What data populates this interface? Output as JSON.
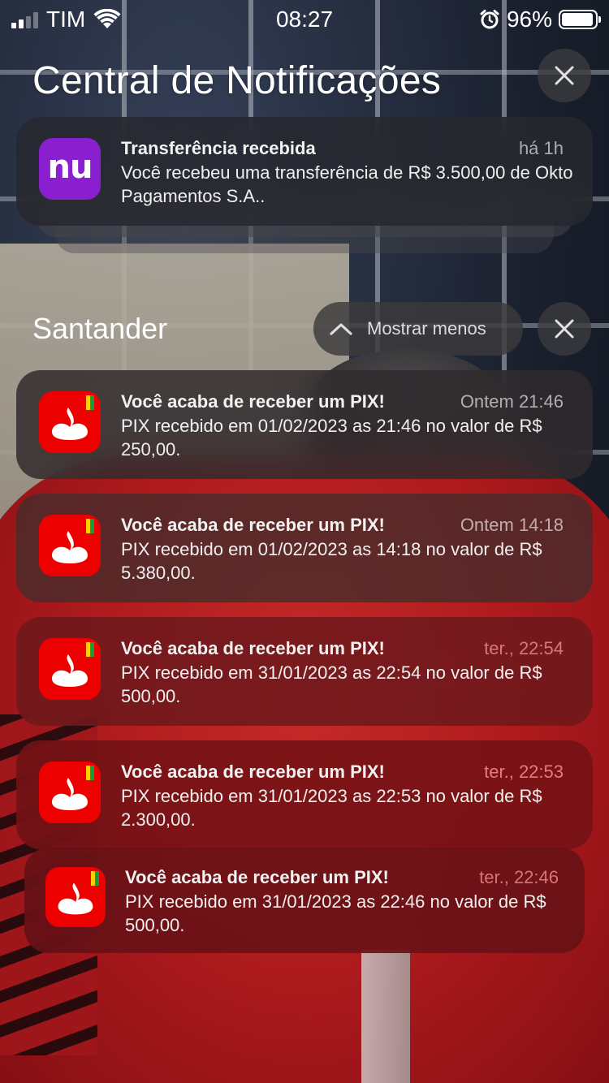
{
  "status_bar": {
    "carrier": "TIM",
    "time": "08:27",
    "battery_percent": "96%",
    "battery_level": 0.96,
    "signal_bars_active": 2,
    "signal_bars_total": 4
  },
  "notification_center": {
    "title": "Central de Notificações",
    "clear_all_icon": "close-icon"
  },
  "nubank_notification": {
    "app_icon_text": "nu",
    "title": "Transferência recebida",
    "time": "há 1h",
    "body": "Você recebeu uma transferência de R$ 3.500,00 de Okto Pagamentos S.A.."
  },
  "santander_group": {
    "title": "Santander",
    "show_less_label": "Mostrar menos",
    "notifications": [
      {
        "title": "Você acaba de receber um PIX!",
        "time": "Ontem 21:46",
        "body": "PIX recebido em 01/02/2023 as 21:46 no valor de R$ 250,00."
      },
      {
        "title": "Você acaba de receber um PIX!",
        "time": "Ontem 14:18",
        "body": "PIX recebido em 01/02/2023 as 14:18 no valor de R$ 5.380,00."
      },
      {
        "title": "Você acaba de receber um PIX!",
        "time": "ter., 22:54",
        "body": "PIX recebido em 31/01/2023 as 22:54 no valor de R$ 500,00."
      },
      {
        "title": "Você acaba de receber um PIX!",
        "time": "ter., 22:53",
        "body": "PIX recebido em 31/01/2023 as 22:53 no valor de R$ 2.300,00."
      },
      {
        "title": "Você acaba de receber um PIX!",
        "time": "ter., 22:46",
        "body": "PIX recebido em 31/01/2023 as 22:46 no valor de R$ 500,00."
      }
    ]
  },
  "colors": {
    "nubank_purple": "#8a1fd0",
    "santander_red": "#ec0000"
  }
}
